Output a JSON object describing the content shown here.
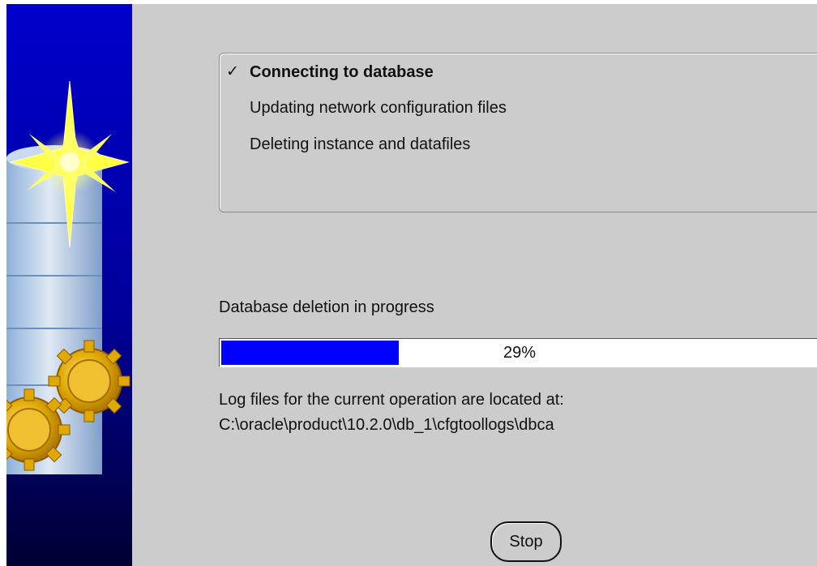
{
  "steps": [
    {
      "label": "Connecting to database",
      "status": "done",
      "mark": "✓"
    },
    {
      "label": "Updating network configuration files",
      "status": "pending",
      "mark": ""
    },
    {
      "label": "Deleting instance and datafiles",
      "status": "pending",
      "mark": ""
    }
  ],
  "progress": {
    "label": "Database deletion in progress",
    "percent": 29,
    "percent_text": "29%",
    "fill_color": "#0000ff"
  },
  "log": {
    "line1": "Log files for the current operation are located at:",
    "line2": "C:\\oracle\\product\\10.2.0\\db_1\\cfgtoollogs\\dbca"
  },
  "buttons": {
    "stop_label": "Stop"
  },
  "side_panel": {
    "icons": [
      "star-burst-icon",
      "database-cylinder-icon",
      "gear-icon"
    ],
    "colors": {
      "background_top": "#0000cc",
      "background_bottom": "#000033",
      "star": "#ffff44",
      "gear": "#e0b000"
    }
  }
}
